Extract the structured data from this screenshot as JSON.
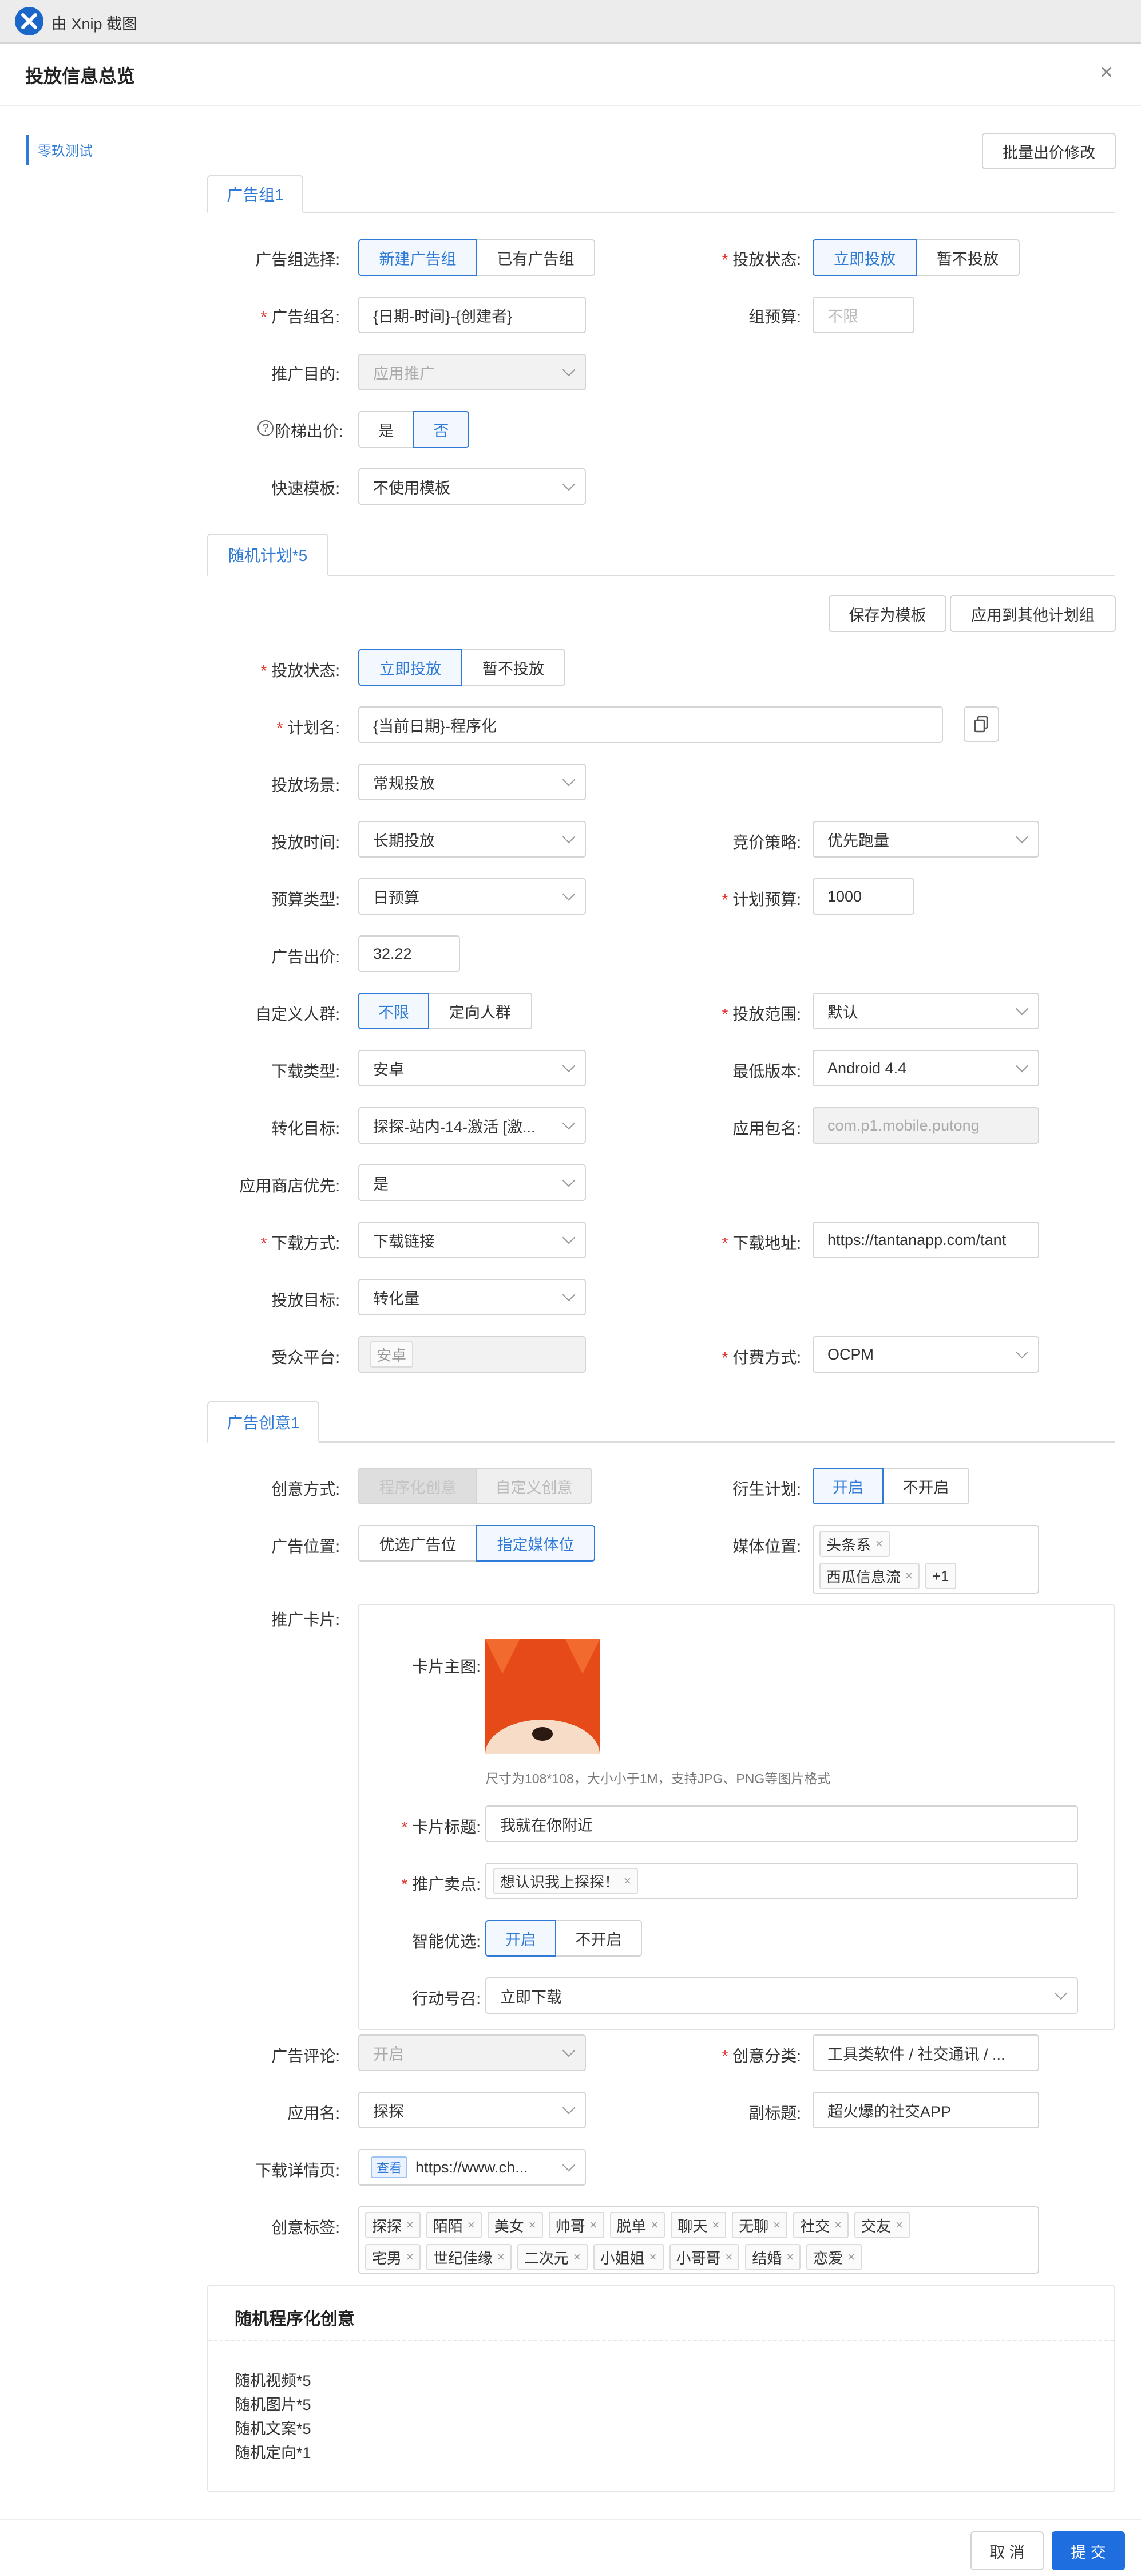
{
  "window": {
    "title": "由 Xnip 截图"
  },
  "header": {
    "title": "投放信息总览",
    "close": "×"
  },
  "nav": {
    "item": "零玖测试"
  },
  "toolbar": {
    "batch_bid": "批量出价修改",
    "save_template": "保存为模板",
    "apply_other": "应用到其他计划组"
  },
  "group": {
    "tab": "广告组1",
    "select_label": "广告组选择:",
    "select_opts": [
      "新建广告组",
      "已有广告组"
    ],
    "status_label": "投放状态:",
    "status_opts": [
      "立即投放",
      "暂不投放"
    ],
    "name_label": "广告组名:",
    "name_value": "{日期-时间}-{创建者}",
    "budget_label": "组预算:",
    "budget_placeholder": "不限",
    "purpose_label": "推广目的:",
    "purpose_value": "应用推广",
    "ladder_label": "阶梯出价:",
    "ladder_opts": [
      "是",
      "否"
    ],
    "template_label": "快速模板:",
    "template_value": "不使用模板"
  },
  "plan": {
    "tab": "随机计划*5",
    "status_label": "投放状态:",
    "status_opts": [
      "立即投放",
      "暂不投放"
    ],
    "name_label": "计划名:",
    "name_value": "{当前日期}-程序化",
    "scene_label": "投放场景:",
    "scene_value": "常规投放",
    "time_label": "投放时间:",
    "time_value": "长期投放",
    "bid_strategy_label": "竞价策略:",
    "bid_strategy_value": "优先跑量",
    "budget_type_label": "预算类型:",
    "budget_type_value": "日预算",
    "budget_label": "计划预算:",
    "budget_value": "1000",
    "bid_label": "广告出价:",
    "bid_value": "32.22",
    "audience_label": "自定义人群:",
    "audience_opts": [
      "不限",
      "定向人群"
    ],
    "range_label": "投放范围:",
    "range_value": "默认",
    "download_type_label": "下载类型:",
    "download_type_value": "安卓",
    "min_version_label": "最低版本:",
    "min_version_value": "Android 4.4",
    "conversion_label": "转化目标:",
    "conversion_value": "探探-站内-14-激活 [激...",
    "package_label": "应用包名:",
    "package_value": "com.p1.mobile.putong",
    "store_label": "应用商店优先:",
    "store_value": "是",
    "download_method_label": "下载方式:",
    "download_method_value": "下载链接",
    "download_url_label": "下载地址:",
    "download_url_value": "https://tantanapp.com/tant",
    "target_label": "投放目标:",
    "target_value": "转化量",
    "platform_label": "受众平台:",
    "platform_value": "安卓",
    "payment_label": "付费方式:",
    "payment_value": "OCPM"
  },
  "creative": {
    "tab": "广告创意1",
    "method_label": "创意方式:",
    "method_opts": [
      "程序化创意",
      "自定义创意"
    ],
    "derive_label": "衍生计划:",
    "derive_opts": [
      "开启",
      "不开启"
    ],
    "position_label": "广告位置:",
    "position_opts": [
      "优选广告位",
      "指定媒体位"
    ],
    "media_label": "媒体位置:",
    "media_tags": [
      "头条系",
      "西瓜信息流"
    ],
    "media_more": "+1",
    "card_label": "推广卡片:",
    "card": {
      "image_label": "卡片主图:",
      "image_hint": "尺寸为108*108，大小小于1M，支持JPG、PNG等图片格式",
      "title_label": "卡片标题:",
      "title_value": "我就在你附近",
      "selling_label": "推广卖点:",
      "selling_tags": [
        "想认识我上探探！"
      ],
      "smart_label": "智能优选:",
      "smart_opts": [
        "开启",
        "不开启"
      ],
      "cta_label": "行动号召:",
      "cta_value": "立即下载"
    },
    "comment_label": "广告评论:",
    "comment_value": "开启",
    "category_label": "创意分类:",
    "category_value": "工具类软件 / 社交通讯 / ...",
    "app_label": "应用名:",
    "app_value": "探探",
    "subtitle_label": "副标题:",
    "subtitle_value": "超火爆的社交APP",
    "detail_label": "下载详情页:",
    "detail_badge": "查看",
    "detail_value": "https://www.ch...",
    "tags_label": "创意标签:",
    "tags_row1": [
      "探探",
      "陌陌",
      "美女",
      "帅哥",
      "脱单",
      "聊天",
      "无聊",
      "社交",
      "交友"
    ],
    "tags_row2": [
      "宅男",
      "世纪佳缘",
      "二次元",
      "小姐姐",
      "小哥哥",
      "结婚",
      "恋爱"
    ]
  },
  "random": {
    "title": "随机程序化创意",
    "lines": [
      "随机视频*5",
      "随机图片*5",
      "随机文案*5",
      "随机定向*1"
    ]
  },
  "footer": {
    "cancel": "取 消",
    "submit": "提 交"
  },
  "colors": {
    "accent": "#2f7ad6",
    "primary": "#1e6ee0",
    "required": "#e0342f"
  }
}
